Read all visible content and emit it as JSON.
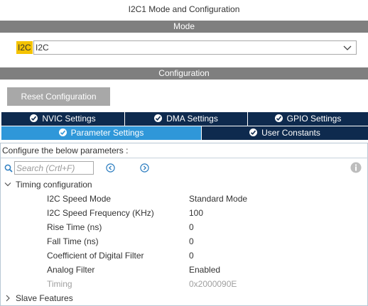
{
  "window": {
    "title": "I2C1 Mode and Configuration"
  },
  "mode_section": {
    "header": "Mode",
    "label": "I2C",
    "select_value": "I2C"
  },
  "config_section": {
    "header": "Configuration",
    "reset_button": "Reset Configuration"
  },
  "tabs_row1": [
    {
      "label": "NVIC Settings"
    },
    {
      "label": "DMA Settings"
    },
    {
      "label": "GPIO Settings"
    }
  ],
  "tabs_row2": [
    {
      "label": "Parameter Settings",
      "active": true
    },
    {
      "label": "User Constants",
      "active": false
    }
  ],
  "panel": {
    "intro": "Configure the below parameters :",
    "search_placeholder": "Search (Crtl+F)",
    "groups": [
      {
        "label": "Timing configuration",
        "expanded": true,
        "params": [
          {
            "name": "I2C Speed Mode",
            "value": "Standard Mode"
          },
          {
            "name": "I2C Speed Frequency (KHz)",
            "value": "100"
          },
          {
            "name": "Rise Time (ns)",
            "value": "0"
          },
          {
            "name": "Fall Time (ns)",
            "value": "0"
          },
          {
            "name": "Coefficient of Digital Filter",
            "value": "0"
          },
          {
            "name": "Analog Filter",
            "value": "Enabled"
          },
          {
            "name": "Timing",
            "value": "0x2000090E",
            "disabled": true
          }
        ]
      },
      {
        "label": "Slave Features",
        "expanded": false
      }
    ]
  },
  "colors": {
    "section_bar": "#7f7f7f",
    "tab_dark": "#0e2a4e",
    "tab_active": "#2f97d9",
    "mode_highlight": "#f4c300"
  },
  "icons": [
    "chevron-down-icon",
    "check-circle-icon",
    "search-icon",
    "prev-icon",
    "next-icon",
    "info-icon",
    "expand-arrow-icon",
    "collapse-arrow-icon"
  ]
}
